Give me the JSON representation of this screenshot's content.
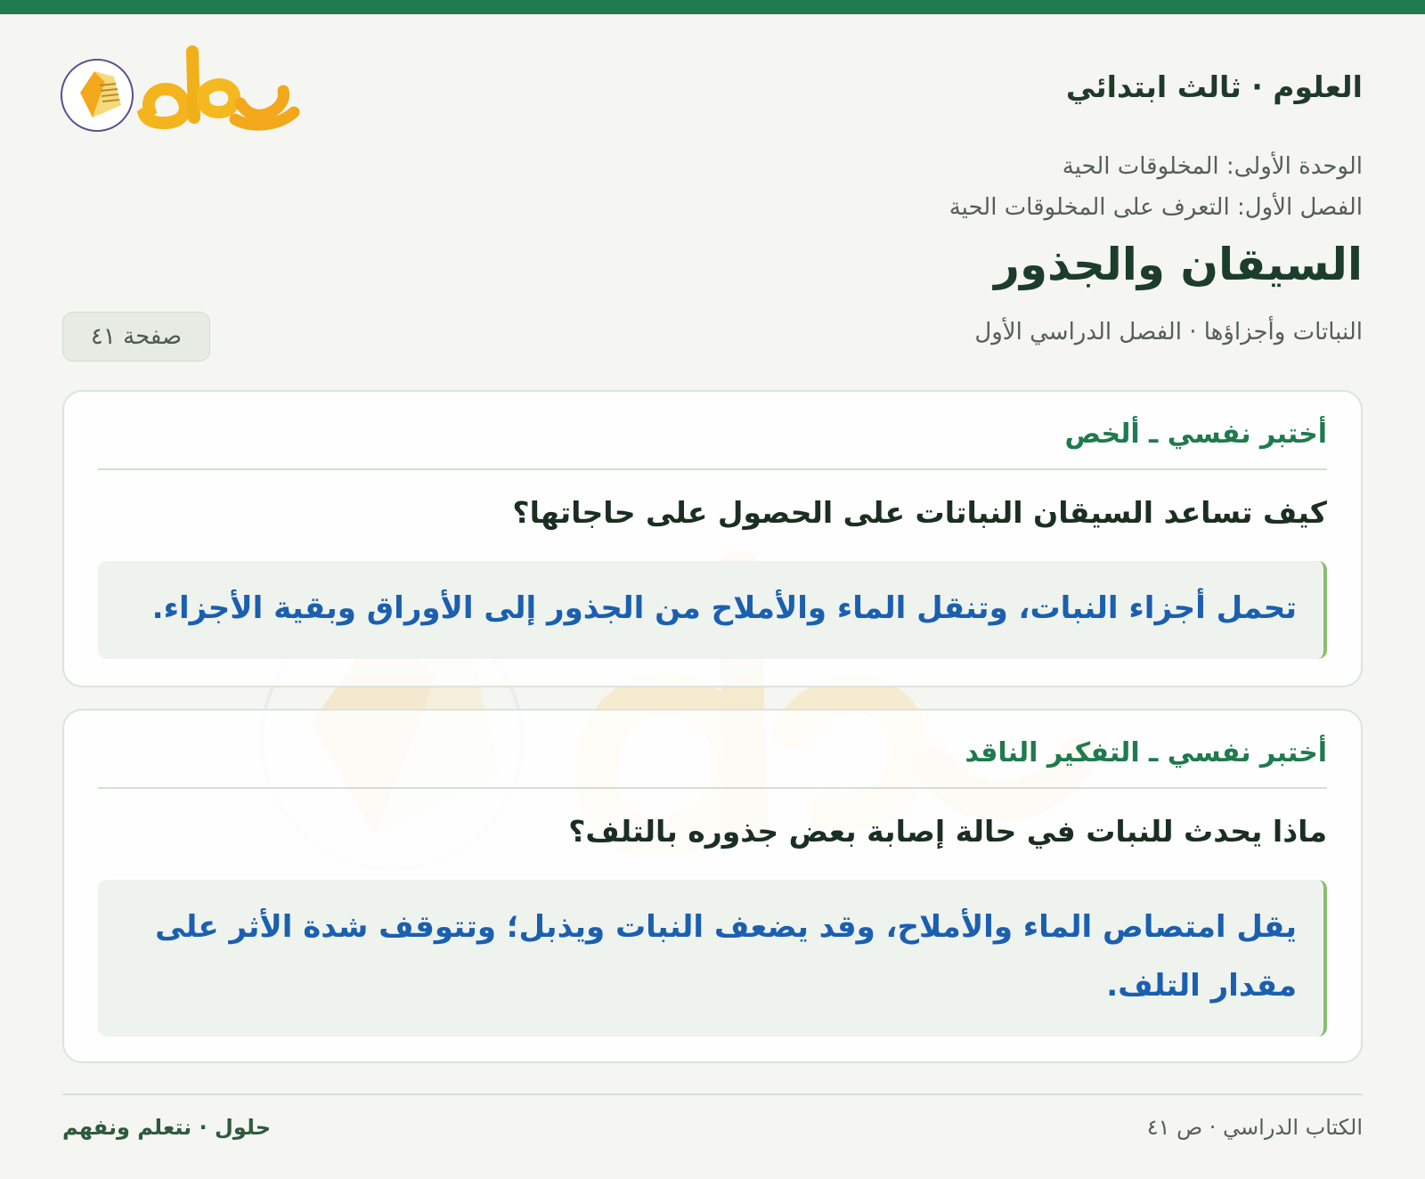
{
  "header": {
    "subject": "العلوم · ثالث ابتدائي",
    "logo_text": "حلول",
    "unit": "الوحدة الأولى: المخلوقات الحية",
    "chapter": "الفصل الأول: التعرف على المخلوقات الحية",
    "lesson_title": "السيقان والجذور",
    "meta": "النباتات وأجزاؤها · الفصل الدراسي الأول",
    "page_badge": "صفحة ٤١"
  },
  "cards": [
    {
      "label": "أختبر نفسي ـ ألخص",
      "question": "كيف تساعد السيقان النباتات على الحصول على حاجاتها؟",
      "answer": "تحمل أجزاء النبات، وتنقل الماء والأملاح من الجذور إلى الأوراق وبقية الأجزاء."
    },
    {
      "label": "أختبر نفسي ـ التفكير الناقد",
      "question": "ماذا يحدث للنبات في حالة إصابة بعض جذوره بالتلف؟",
      "answer": "يقل امتصاص الماء والأملاح، وقد يضعف النبات ويذبل؛ وتتوقف شدة الأثر على مقدار التلف."
    }
  ],
  "footer": {
    "right": "الكتاب الدراسي · ص ٤١",
    "left": "حلول · نتعلم ونفهم"
  },
  "colors": {
    "accent": "#1f7a4d",
    "answer_text": "#1b5fb0",
    "logo_gold": "#f2b21a"
  }
}
